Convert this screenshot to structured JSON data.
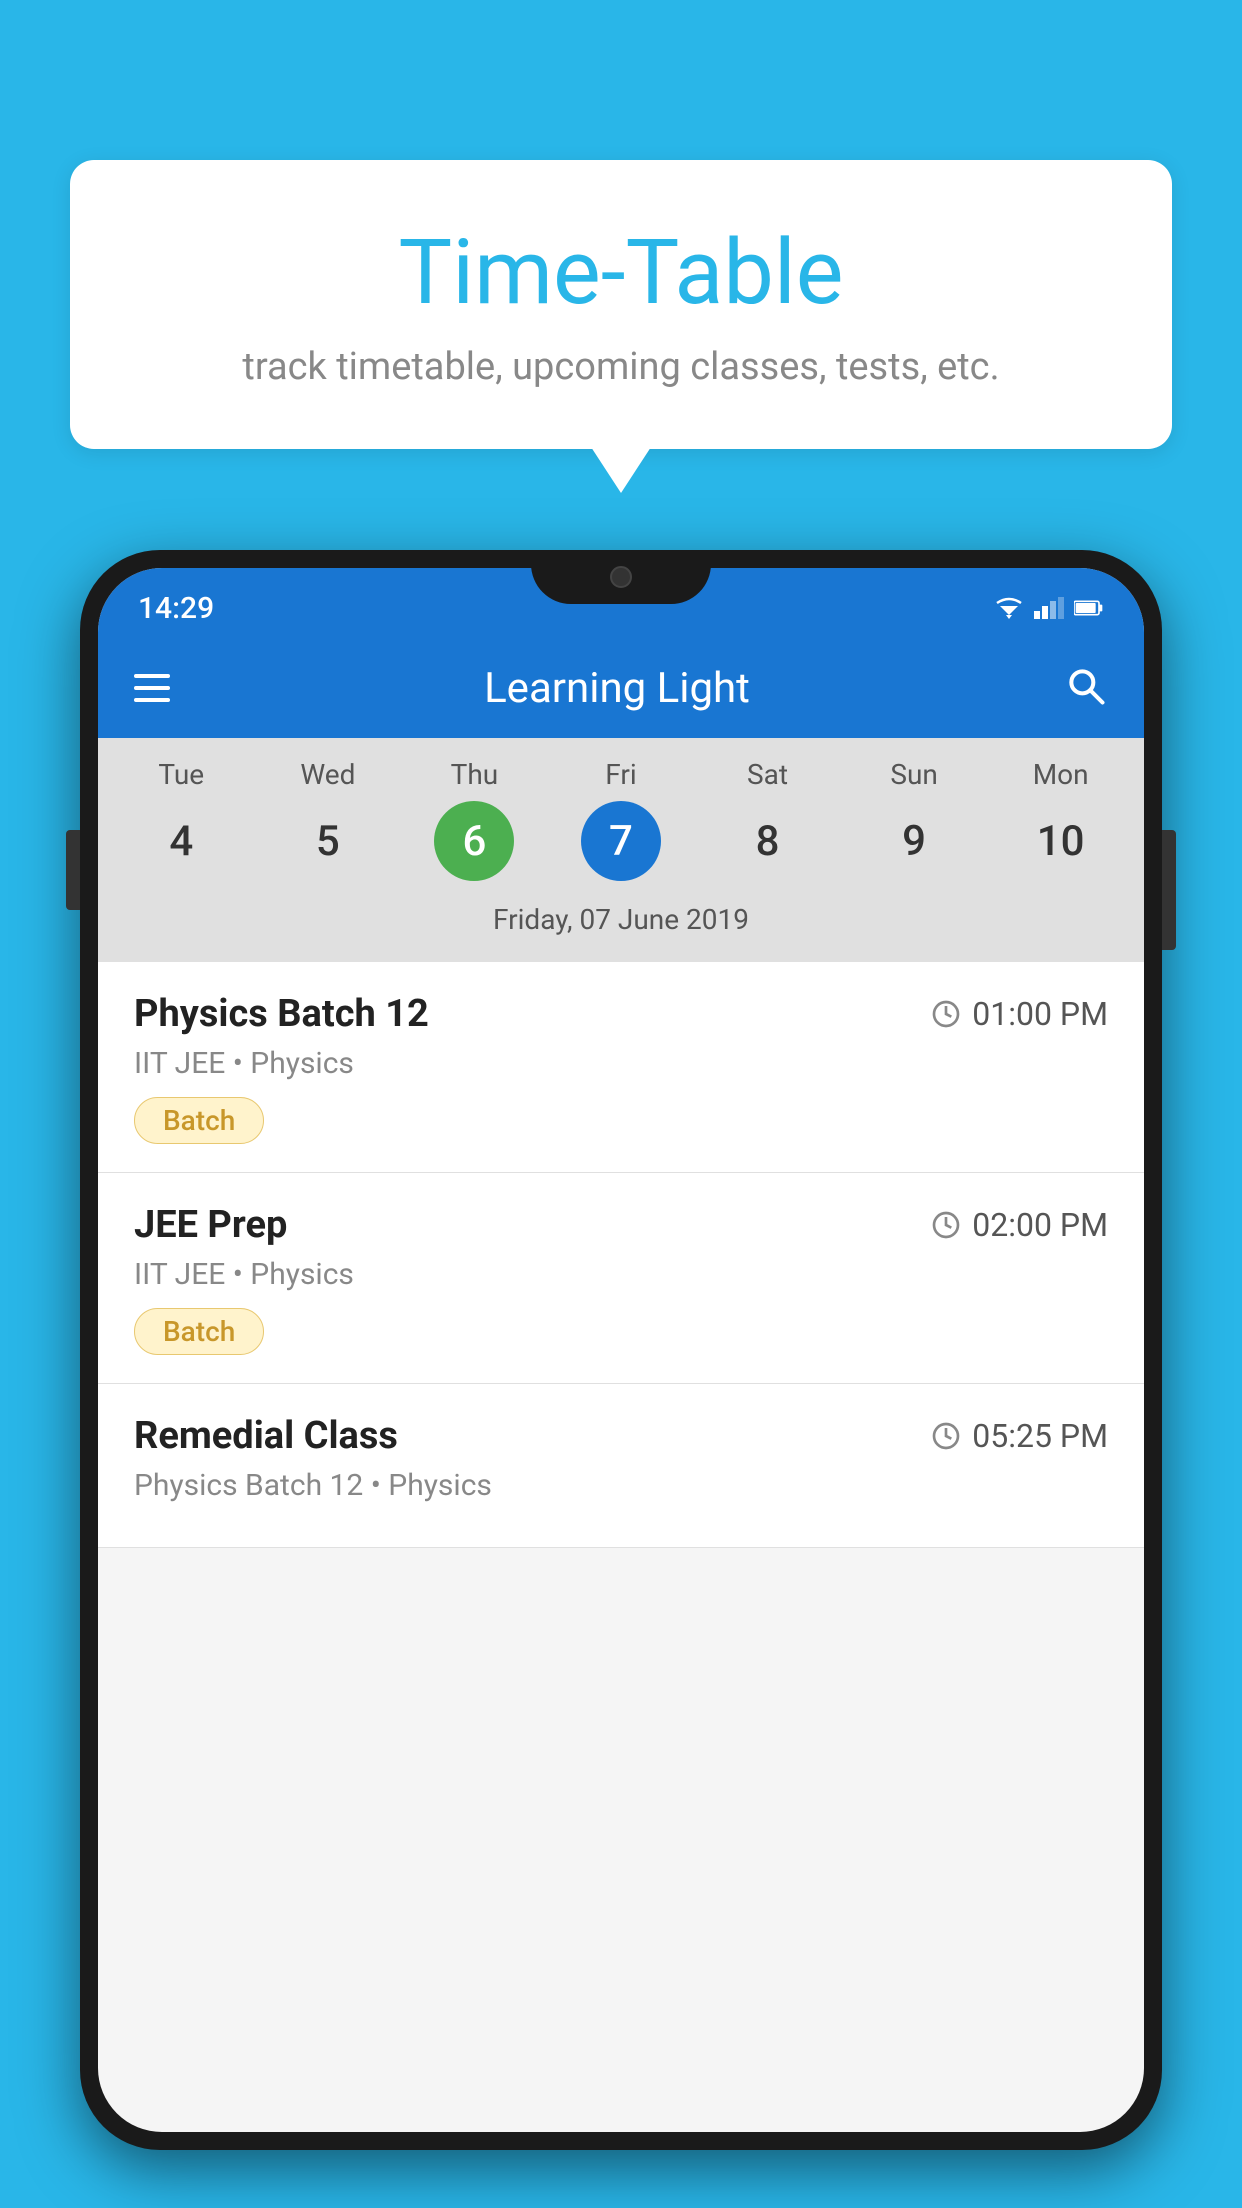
{
  "background_color": "#29B6E8",
  "speech_bubble": {
    "title": "Time-Table",
    "subtitle": "track timetable, upcoming classes, tests, etc."
  },
  "phone": {
    "status_bar": {
      "time": "14:29"
    },
    "app_bar": {
      "title": "Learning Light"
    },
    "calendar": {
      "days": [
        {
          "name": "Tue",
          "num": "4",
          "state": "normal"
        },
        {
          "name": "Wed",
          "num": "5",
          "state": "normal"
        },
        {
          "name": "Thu",
          "num": "6",
          "state": "today"
        },
        {
          "name": "Fri",
          "num": "7",
          "state": "selected"
        },
        {
          "name": "Sat",
          "num": "8",
          "state": "normal"
        },
        {
          "name": "Sun",
          "num": "9",
          "state": "normal"
        },
        {
          "name": "Mon",
          "num": "10",
          "state": "normal"
        }
      ],
      "selected_date_label": "Friday, 07 June 2019"
    },
    "schedule": [
      {
        "title": "Physics Batch 12",
        "time": "01:00 PM",
        "subtitle": "IIT JEE • Physics",
        "badge": "Batch"
      },
      {
        "title": "JEE Prep",
        "time": "02:00 PM",
        "subtitle": "IIT JEE • Physics",
        "badge": "Batch"
      },
      {
        "title": "Remedial Class",
        "time": "05:25 PM",
        "subtitle": "Physics Batch 12 • Physics",
        "badge": null
      }
    ]
  }
}
